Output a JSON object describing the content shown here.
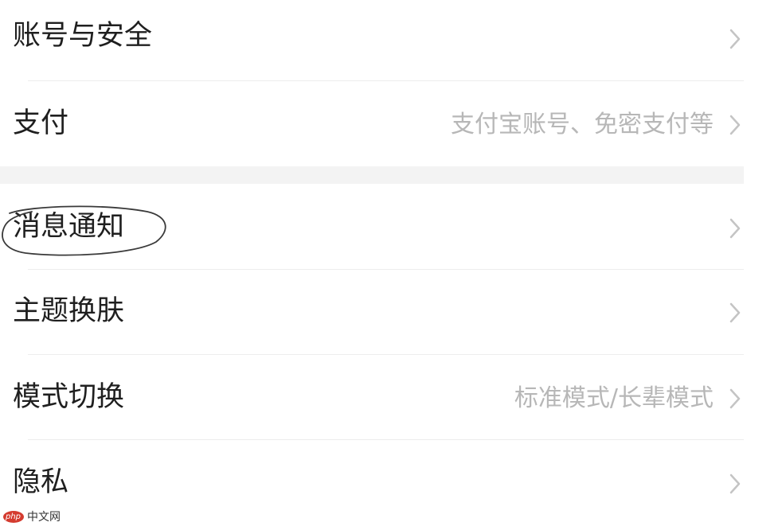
{
  "settings": {
    "items": [
      {
        "label": "账号与安全",
        "value": "",
        "chevron_icon": "chevron-right-icon"
      },
      {
        "label": "支付",
        "value": "支付宝账号、免密支付等",
        "chevron_icon": "chevron-right-icon"
      },
      {
        "label": "消息通知",
        "value": "",
        "chevron_icon": "chevron-right-icon"
      },
      {
        "label": "主题换肤",
        "value": "",
        "chevron_icon": "chevron-right-icon"
      },
      {
        "label": "模式切换",
        "value": "标准模式/长辈模式",
        "chevron_icon": "chevron-right-icon"
      },
      {
        "label": "隐私",
        "value": "",
        "chevron_icon": "chevron-right-icon"
      }
    ]
  },
  "annotation": {
    "icon": "hand-drawn-circle",
    "color": "#3a3a3a"
  },
  "watermark": {
    "logo_text": "php",
    "text": "中文网",
    "logo_color": "#d43b2f"
  },
  "colors": {
    "label": "#1f1f1f",
    "value": "#b7b7b7",
    "chevron": "#c4c4c4",
    "divider": "#ededed",
    "section_gap": "#f3f3f3"
  }
}
